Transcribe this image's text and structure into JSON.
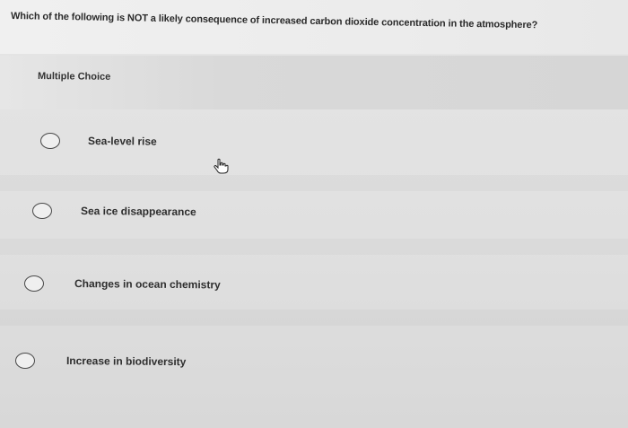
{
  "question": {
    "text": "Which of the following is NOT a likely consequence of increased carbon dioxide concentration in the atmosphere?"
  },
  "question_type": {
    "label": "Multiple Choice"
  },
  "options": [
    {
      "label": "Sea-level rise",
      "selected": false
    },
    {
      "label": "Sea ice disappearance",
      "selected": false
    },
    {
      "label": "Changes in ocean chemistry",
      "selected": false
    },
    {
      "label": "Increase in biodiversity",
      "selected": false
    }
  ],
  "cursor": {
    "icon": "hand-pointer-icon"
  }
}
